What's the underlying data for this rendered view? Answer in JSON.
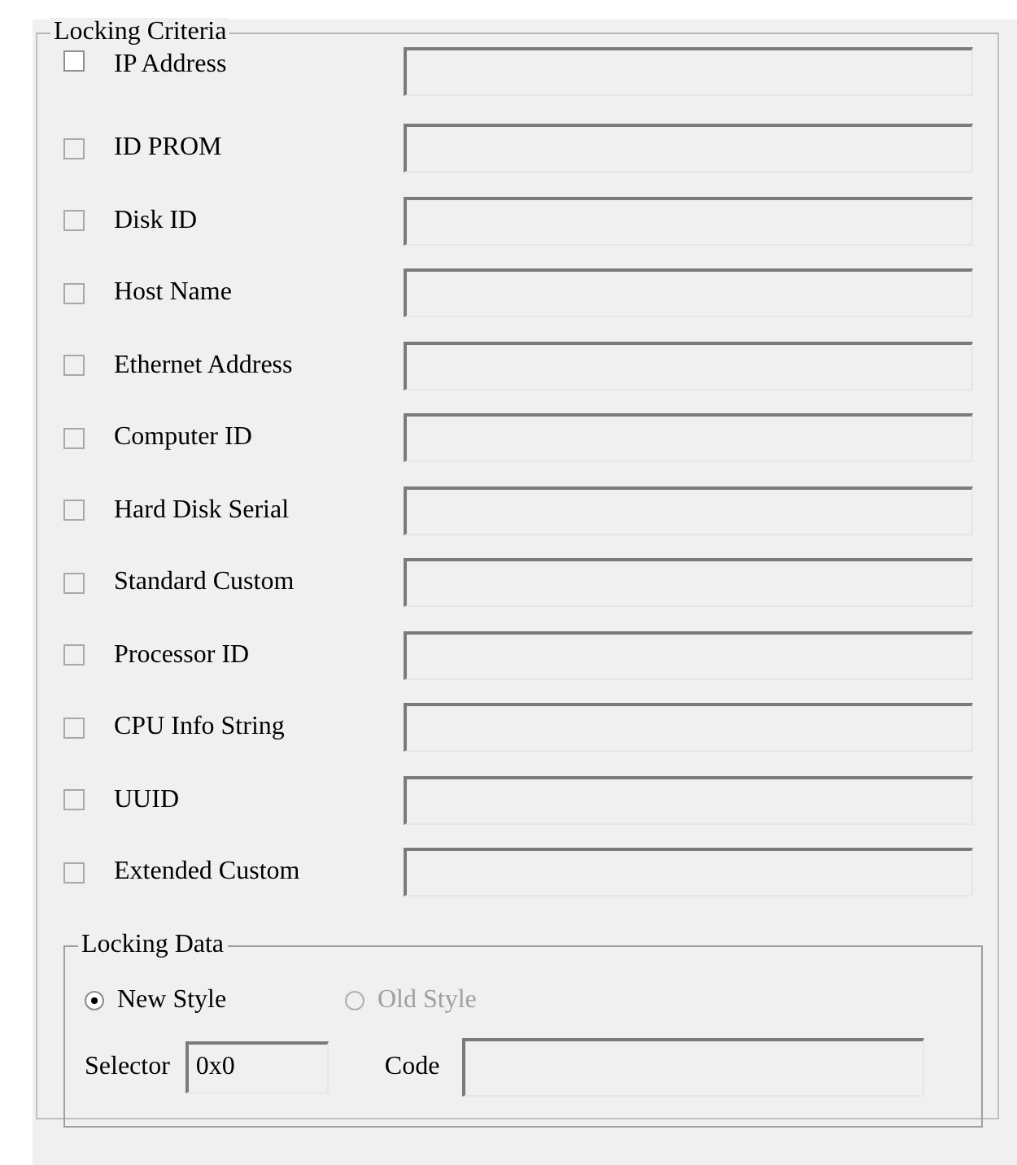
{
  "locking_criteria": {
    "title": "Locking Criteria",
    "items": [
      {
        "label": "IP Address",
        "checked": false,
        "disabled": false
      },
      {
        "label": "ID PROM",
        "checked": false,
        "disabled": true
      },
      {
        "label": "Disk ID",
        "checked": false,
        "disabled": true
      },
      {
        "label": "Host Name",
        "checked": false,
        "disabled": true
      },
      {
        "label": "Ethernet Address",
        "checked": false,
        "disabled": true
      },
      {
        "label": "Computer ID",
        "checked": false,
        "disabled": true
      },
      {
        "label": "Hard Disk Serial",
        "checked": false,
        "disabled": true
      },
      {
        "label": "Standard Custom",
        "checked": false,
        "disabled": true
      },
      {
        "label": "Processor ID",
        "checked": false,
        "disabled": true
      },
      {
        "label": "CPU Info String",
        "checked": false,
        "disabled": true
      },
      {
        "label": "UUID",
        "checked": false,
        "disabled": true
      },
      {
        "label": "Extended Custom",
        "checked": false,
        "disabled": true
      }
    ]
  },
  "locking_data": {
    "title": "Locking Data",
    "options": [
      {
        "label": "New Style",
        "selected": true,
        "disabled": false
      },
      {
        "label": "Old Style",
        "selected": false,
        "disabled": true
      }
    ],
    "selector": {
      "label": "Selector",
      "value": "0x0"
    },
    "code": {
      "label": "Code"
    }
  }
}
